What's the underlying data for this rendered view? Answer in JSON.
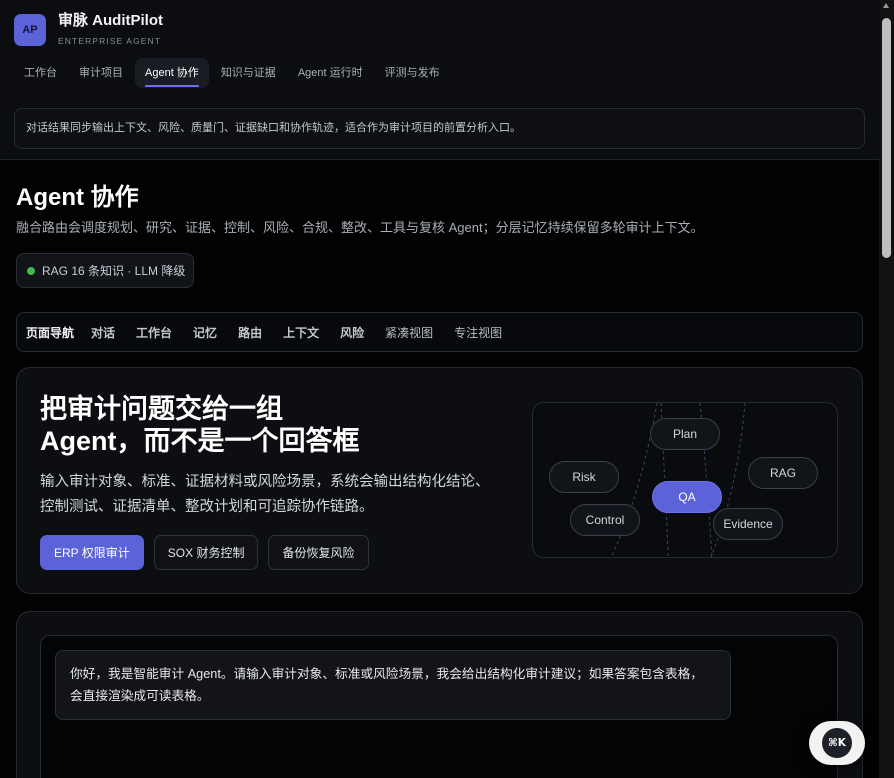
{
  "brand": {
    "logo_text": "AP",
    "name": "审脉 AuditPilot",
    "tagline": "ENTERPRISE AGENT"
  },
  "nav": {
    "tabs": [
      {
        "label": "工作台",
        "active": false
      },
      {
        "label": "审计项目",
        "active": false
      },
      {
        "label": "Agent 协作",
        "active": true
      },
      {
        "label": "知识与证据",
        "active": false
      },
      {
        "label": "Agent 运行时",
        "active": false
      },
      {
        "label": "评测与发布",
        "active": false
      }
    ]
  },
  "banner": {
    "text": "对话结果同步输出上下文、风险、质量门、证据缺口和协作轨迹，适合作为审计项目的前置分析入口。"
  },
  "page": {
    "title": "Agent 协作",
    "subtitle": "融合路由会调度规划、研究、证据、控制、风险、合规、整改、工具与复核 Agent；分层记忆持续保留多轮审计上下文。"
  },
  "status_badge": {
    "text": "RAG 16 条知识 · LLM 降级",
    "dot_color": "#3fb950"
  },
  "page_nav": {
    "label": "页面导航",
    "items": [
      "对话",
      "工作台",
      "记忆",
      "路由",
      "上下文",
      "风险",
      "紧凑视图",
      "专注视图"
    ]
  },
  "hero": {
    "title_lines": [
      "把审计问题交给一组",
      "Agent，而不是一个回答框"
    ],
    "description_lines": [
      "输入审计对象、标准、证据材料或风险场景，系统会输出结构化结论、",
      "控制测试、证据清单、整改计划和可追踪协作链路。"
    ],
    "buttons": [
      {
        "label": "ERP 权限审计",
        "primary": true
      },
      {
        "label": "SOX 财务控制",
        "primary": false
      },
      {
        "label": "备份恢复风险",
        "primary": false
      }
    ],
    "diagram": {
      "nodes": [
        {
          "label": "Plan",
          "active": false
        },
        {
          "label": "Risk",
          "active": false
        },
        {
          "label": "RAG",
          "active": false
        },
        {
          "label": "QA",
          "active": true
        },
        {
          "label": "Control",
          "active": false
        },
        {
          "label": "Evidence",
          "active": false
        }
      ]
    }
  },
  "chat": {
    "messages": [
      {
        "text": "你好，我是智能审计 Agent。请输入审计对象、标准或风险场景，我会给出结构化审计建议；如果答案包含表格，会直接渲染成可读表格。"
      }
    ]
  },
  "command_palette": {
    "shortcut_label": "⌘K"
  },
  "colors": {
    "accent": "#5c63d8",
    "background": "#020203",
    "header": "#0b0d11",
    "card": "#0c0e12",
    "status_ok": "#3fb950"
  },
  "icons": {
    "status": "status-dot",
    "command": "command-key-icon",
    "scroll_up": "scroll-up-arrow-icon"
  }
}
